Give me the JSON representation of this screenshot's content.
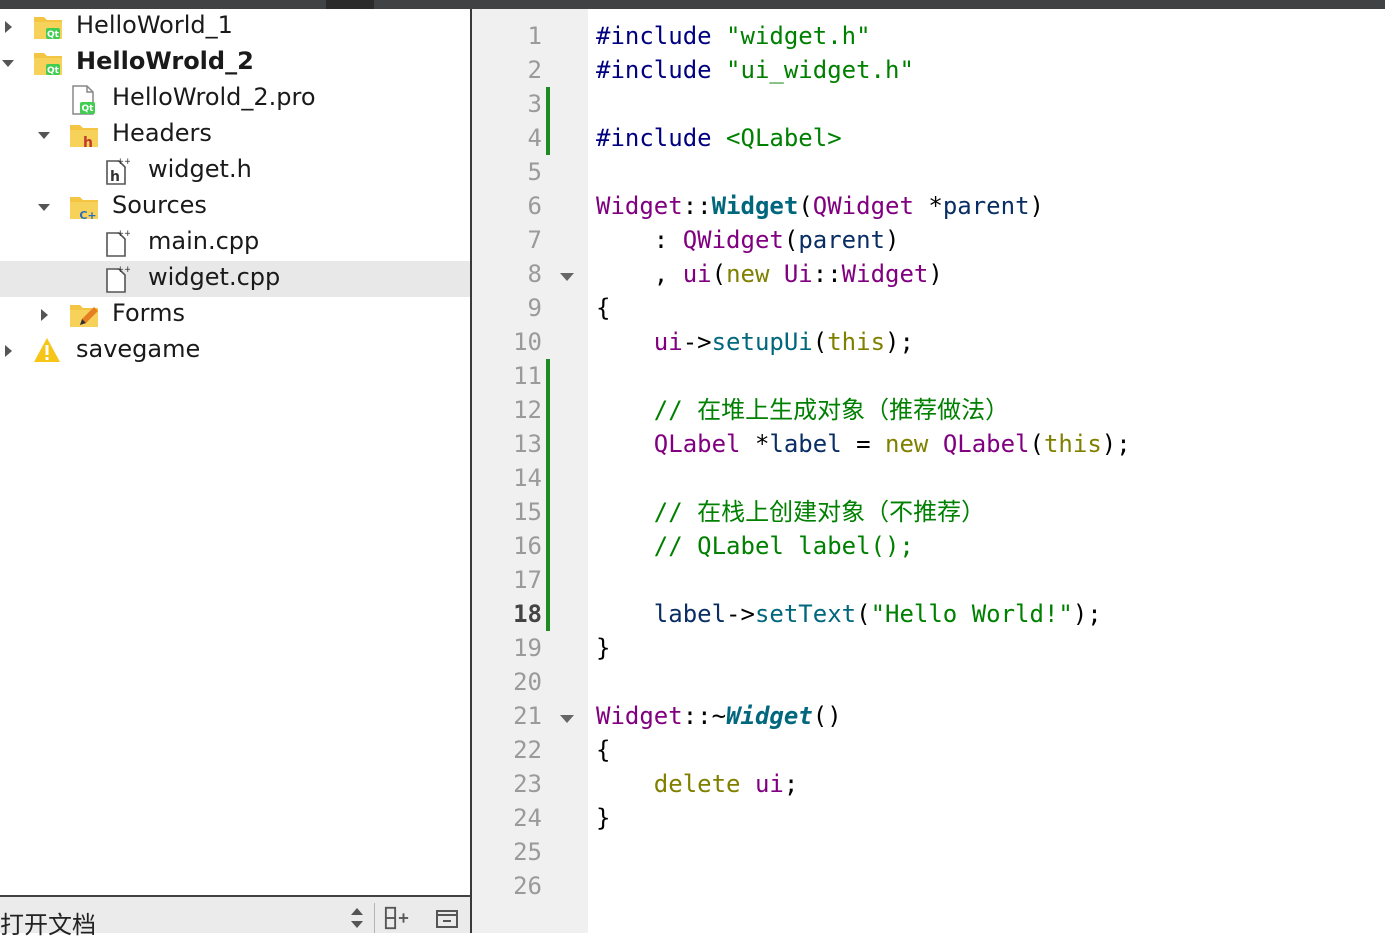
{
  "project_tree": [
    {
      "label": "HelloWorld_1",
      "arrow": "right",
      "icon": "qt-project-folder-icon",
      "depth": 0,
      "bold": false,
      "selected": false
    },
    {
      "label": "HelloWrold_2",
      "arrow": "down",
      "icon": "qt-project-folder-icon",
      "depth": 0,
      "bold": true,
      "selected": false
    },
    {
      "label": "HelloWrold_2.pro",
      "arrow": "none",
      "icon": "qt-pro-file-icon",
      "depth": 1,
      "bold": false,
      "selected": false
    },
    {
      "label": "Headers",
      "arrow": "down",
      "icon": "headers-folder-icon",
      "depth": 1,
      "bold": false,
      "selected": false
    },
    {
      "label": "widget.h",
      "arrow": "none",
      "icon": "header-file-icon",
      "depth": 2,
      "bold": false,
      "selected": false
    },
    {
      "label": "Sources",
      "arrow": "down",
      "icon": "sources-folder-icon",
      "depth": 1,
      "bold": false,
      "selected": false
    },
    {
      "label": "main.cpp",
      "arrow": "none",
      "icon": "cpp-file-icon",
      "depth": 2,
      "bold": false,
      "selected": false
    },
    {
      "label": "widget.cpp",
      "arrow": "none",
      "icon": "cpp-file-icon",
      "depth": 2,
      "bold": false,
      "selected": true
    },
    {
      "label": "Forms",
      "arrow": "right",
      "icon": "forms-folder-icon",
      "depth": 1,
      "bold": false,
      "selected": false
    },
    {
      "label": "savegame",
      "arrow": "right",
      "icon": "warning-icon",
      "depth": 0,
      "bold": false,
      "selected": false
    }
  ],
  "open_documents": {
    "title": "打开文档"
  },
  "editor": {
    "current_line": 18,
    "lines": [
      [
        [
          "#include ",
          "pre"
        ],
        [
          "\"widget.h\"",
          "str"
        ]
      ],
      [
        [
          "#include ",
          "pre"
        ],
        [
          "\"ui_widget.h\"",
          "str"
        ]
      ],
      [],
      [
        [
          "#include ",
          "pre"
        ],
        [
          "<QLabel>",
          "str"
        ]
      ],
      [],
      [
        [
          "Widget",
          "type"
        ],
        [
          "::",
          "pl"
        ],
        [
          "Widget",
          "fnb"
        ],
        [
          "(",
          "pl"
        ],
        [
          "QWidget",
          "type"
        ],
        [
          " *",
          "pl"
        ],
        [
          "parent",
          "var"
        ],
        [
          ")",
          "pl"
        ]
      ],
      [
        [
          "    : ",
          "pl"
        ],
        [
          "QWidget",
          "type"
        ],
        [
          "(",
          "pl"
        ],
        [
          "parent",
          "var"
        ],
        [
          ")",
          "pl"
        ]
      ],
      [
        [
          "    , ",
          "pl"
        ],
        [
          "ui",
          "type"
        ],
        [
          "(",
          "pl"
        ],
        [
          "new ",
          "kw"
        ],
        [
          "Ui",
          "type"
        ],
        [
          "::",
          "pl"
        ],
        [
          "Widget",
          "type"
        ],
        [
          ")",
          "pl"
        ]
      ],
      [
        [
          "{",
          "pl"
        ]
      ],
      [
        [
          "    ",
          "pl"
        ],
        [
          "ui",
          "type"
        ],
        [
          "->",
          "pl"
        ],
        [
          "setupUi",
          "fn"
        ],
        [
          "(",
          "pl"
        ],
        [
          "this",
          "kw"
        ],
        [
          ");",
          "pl"
        ]
      ],
      [],
      [
        [
          "    // 在堆上生成对象（推荐做法）",
          "cm"
        ]
      ],
      [
        [
          "    ",
          "pl"
        ],
        [
          "QLabel",
          "type"
        ],
        [
          " *",
          "pl"
        ],
        [
          "label",
          "var"
        ],
        [
          " = ",
          "pl"
        ],
        [
          "new ",
          "kw"
        ],
        [
          "QLabel",
          "type"
        ],
        [
          "(",
          "pl"
        ],
        [
          "this",
          "kw"
        ],
        [
          ");",
          "pl"
        ]
      ],
      [],
      [
        [
          "    // 在栈上创建对象（不推荐）",
          "cm"
        ]
      ],
      [
        [
          "    // QLabel label();",
          "cm"
        ]
      ],
      [],
      [
        [
          "    ",
          "pl"
        ],
        [
          "label",
          "var"
        ],
        [
          "->",
          "pl"
        ],
        [
          "setText",
          "fn"
        ],
        [
          "(",
          "pl"
        ],
        [
          "\"Hello World!\"",
          "str"
        ],
        [
          ");",
          "pl"
        ]
      ],
      [
        [
          "}",
          "pl"
        ]
      ],
      [],
      [
        [
          "Widget",
          "type"
        ],
        [
          "::~",
          "pl"
        ],
        [
          "Widget",
          "fni"
        ],
        [
          "()",
          "pl"
        ]
      ],
      [
        [
          "{",
          "pl"
        ]
      ],
      [
        [
          "    ",
          "pl"
        ],
        [
          "delete ",
          "kw"
        ],
        [
          "ui",
          "type"
        ],
        [
          ";",
          "pl"
        ]
      ],
      [
        [
          "}",
          "pl"
        ]
      ],
      [],
      []
    ]
  }
}
